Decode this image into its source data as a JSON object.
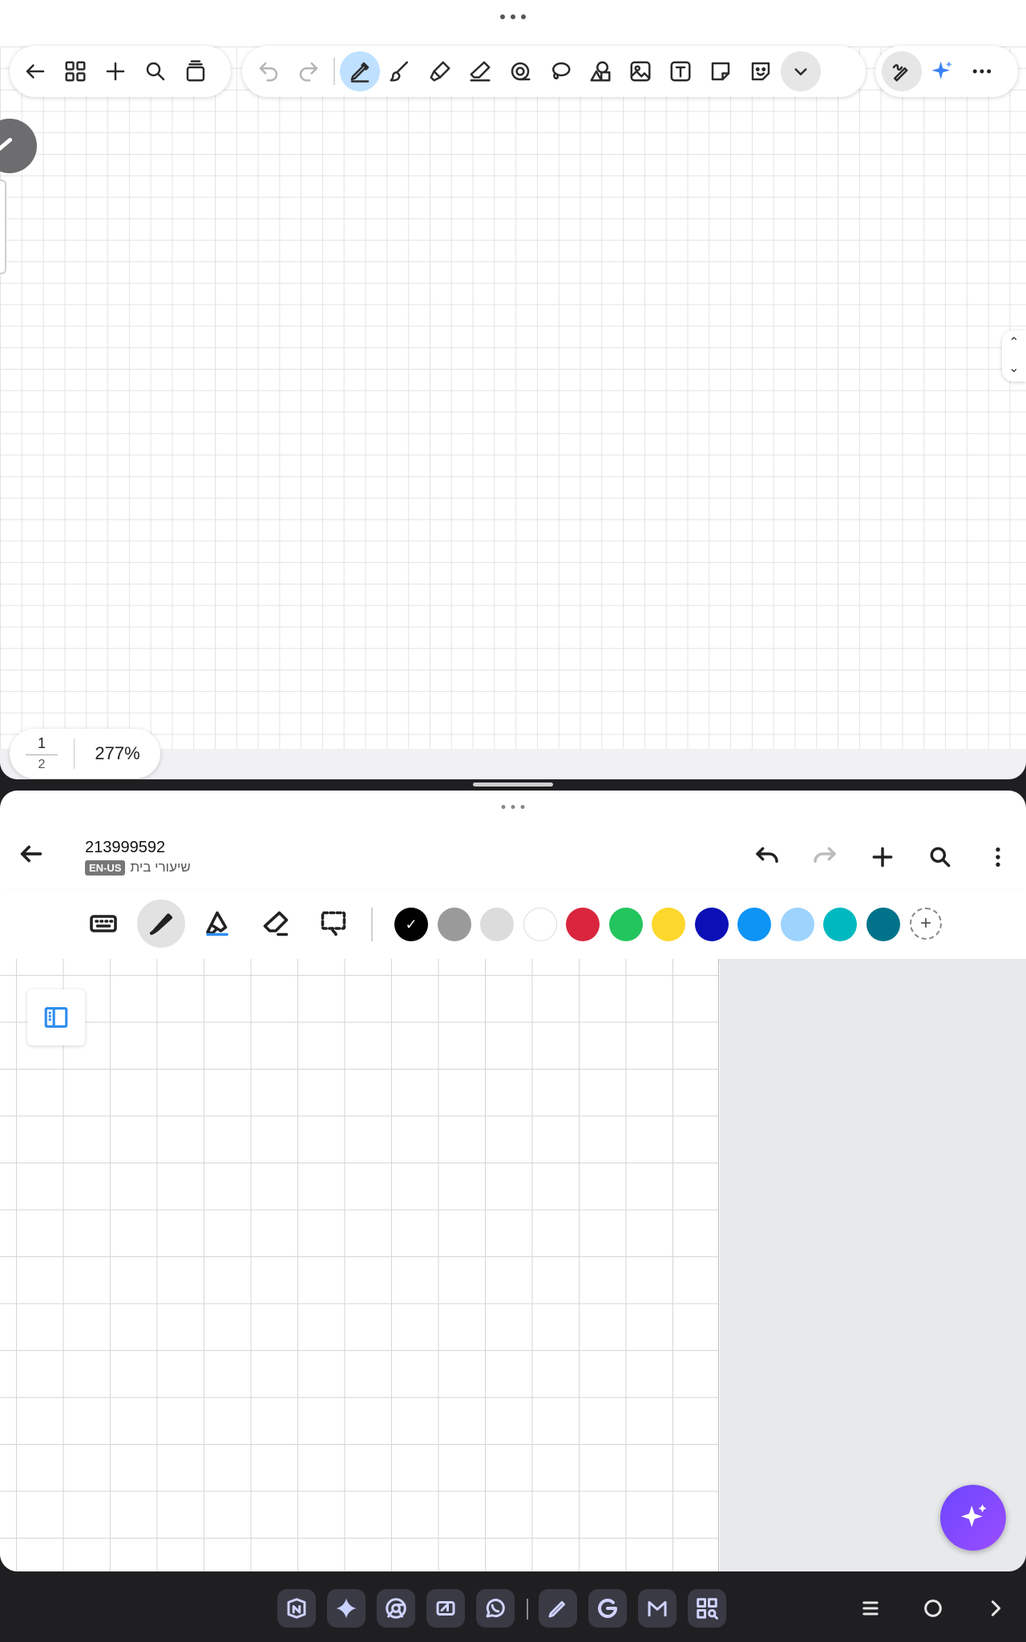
{
  "top_pane": {
    "page_indicator": {
      "current": "1",
      "total": "2"
    },
    "zoom": "277%",
    "toolbar_left_icons": [
      "back-arrow-icon",
      "grid-view-icon",
      "add-icon",
      "search-icon",
      "pages-stack-icon"
    ],
    "toolbar_tools": [
      "undo-icon",
      "redo-icon",
      "pen-icon",
      "brush-icon",
      "highlighter-icon",
      "eraser-icon",
      "tape-icon",
      "lasso-icon",
      "shapes-icon",
      "image-icon",
      "text-box-icon",
      "sticky-note-icon",
      "sticker-icon",
      "chevron-down-icon"
    ],
    "toolbar_right_icons": [
      "handwriting-icon",
      "ai-sparkle-icon",
      "more-icon"
    ],
    "active_tool": "pen-icon",
    "accent": "#bfe0ff"
  },
  "bottom_pane": {
    "title": "213999592",
    "language_badge": "EN-US",
    "folder": "שיעורי בית",
    "header_icons": [
      "undo-icon",
      "redo-icon",
      "add-icon",
      "search-icon",
      "more-vertical-icon"
    ],
    "tools": [
      "keyboard-icon",
      "pen-icon",
      "highlighter-icon",
      "eraser-icon",
      "lasso-select-icon"
    ],
    "active_tool": "pen-icon",
    "swatches": [
      "#000000",
      "#9a9a9a",
      "#dcdcdc",
      "#ffffff",
      "#d9263e",
      "#22c55e",
      "#fcd72c",
      "#0b0fb5",
      "#0d94f5",
      "#9dd3fd",
      "#00b9c0",
      "#00738a"
    ],
    "selected_swatch": "#000000",
    "add_color_symbol": "+"
  },
  "taskbar": {
    "apps": [
      "notion-icon",
      "gemini-icon",
      "chrome-icon",
      "news-icon",
      "whatsapp-icon",
      "notes-pen-icon",
      "google-icon",
      "gmail-icon",
      "apps-search-icon"
    ],
    "nav": [
      "recents-icon",
      "home-icon",
      "back-icon"
    ]
  }
}
